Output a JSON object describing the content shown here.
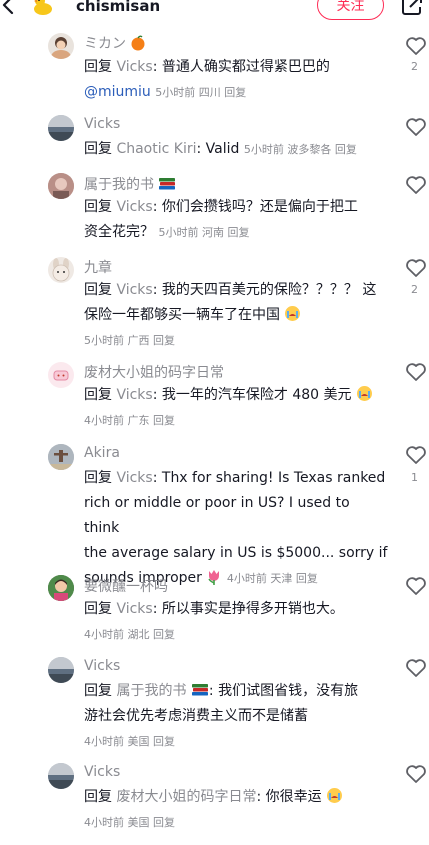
{
  "header": {
    "username": "chismisan",
    "follow_label": "关注"
  },
  "comments": [
    {
      "name": "ミカン",
      "reply_word": "回复",
      "reply_to": "Vicks",
      "text": ": 普通人确实都过得紧巴巴的",
      "mention": "@miumiu",
      "meta": "5小时前 四川 回复",
      "likes": "2"
    },
    {
      "name": "Vicks",
      "reply_word": "回复",
      "reply_to": "Chaotic Kiri",
      "text": ": Valid",
      "meta": "5小时前 波多黎各 回复",
      "likes": ""
    },
    {
      "name": "属于我的书",
      "reply_word": "回复",
      "reply_to": "Vicks",
      "text1": ": 你们会攒钱吗？还是偏向于把工",
      "text2": "资全花完？",
      "meta": "5小时前 河南 回复",
      "likes": ""
    },
    {
      "name": "九章",
      "reply_word": "回复",
      "reply_to": "Vicks",
      "text1": ": 我的天四百美元的保险？？？？ 这",
      "text2": "保险一年都够买一辆车了在中国",
      "meta": "5小时前 广西 回复",
      "likes": "2"
    },
    {
      "name": "废材大小姐的码字日常",
      "reply_word": "回复",
      "reply_to": "Vicks",
      "text": ": 我一年的汽车保险才 480 美元",
      "meta": "4小时前 广东 回复",
      "likes": ""
    },
    {
      "name": "Akira",
      "reply_word": "回复",
      "reply_to": "Vicks",
      "text1": ": Thx for sharing! Is Texas ranked",
      "text2": "rich or middle or poor in US? I used to think",
      "text3": "the average salary in US is $5000... sorry if",
      "text4": "sounds improper",
      "meta": "4小时前 天津 回复",
      "likes": "1"
    },
    {
      "name": "要微醺一杯吗",
      "reply_word": "回复",
      "reply_to": "Vicks",
      "text": ": 所以事实是挣得多开销也大。",
      "meta": "4小时前 湖北 回复",
      "likes": ""
    },
    {
      "name": "Vicks",
      "reply_word": "回复",
      "reply_to": "属于我的书",
      "text1": ": 我们试图省钱，没有旅",
      "text2": "游社会优先考虑消费主义而不是储蓄",
      "meta": "4小时前 美国 回复",
      "likes": ""
    },
    {
      "name": "Vicks",
      "reply_word": "回复",
      "reply_to": "废材大小姐的码字日常",
      "text": ": 你很幸运",
      "meta": "4小时前 美国 回复",
      "likes": ""
    }
  ],
  "colors": {
    "accent": "#fe2c55",
    "secondary_text": "#8a8b91",
    "mention": "#2b5db9"
  }
}
